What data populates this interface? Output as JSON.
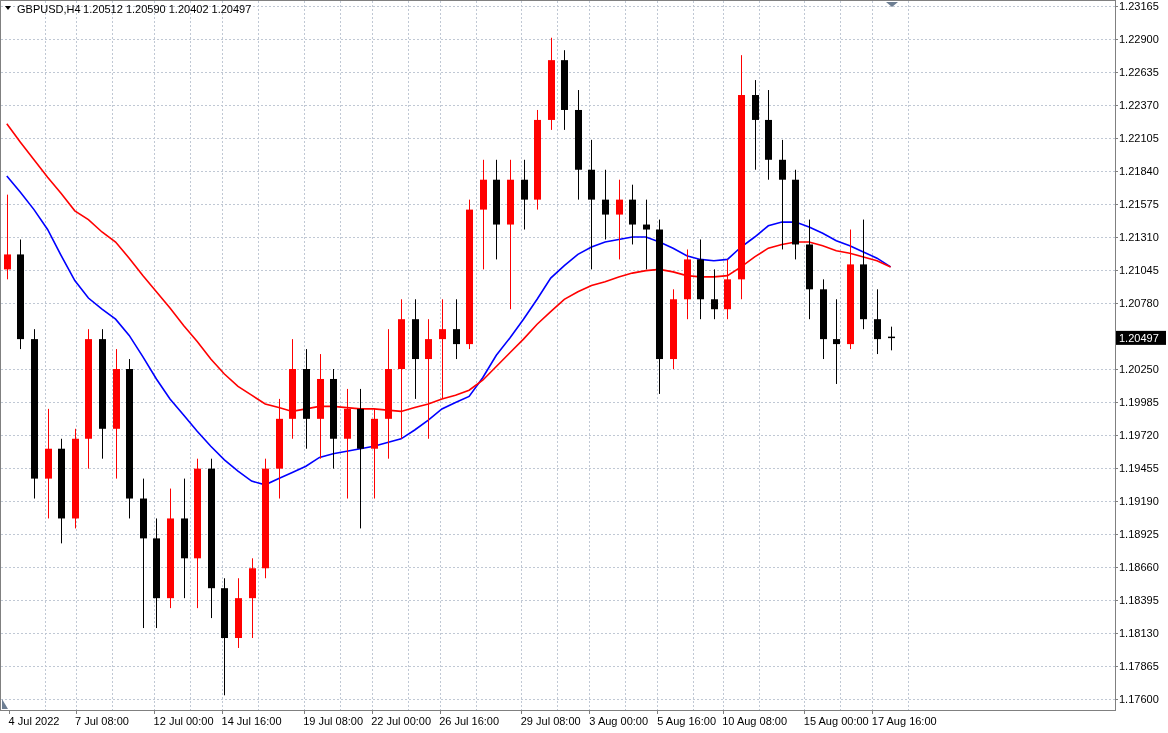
{
  "header": {
    "symbol": "GBPUSD,H4",
    "ohlc": "1.20512 1.20590 1.20402 1.20497"
  },
  "chart_data": {
    "type": "candlestick",
    "grid": true,
    "categories": [
      null,
      null,
      "4 Jul 2022",
      null,
      null,
      null,
      null,
      "7 Jul 08:00",
      null,
      null,
      null,
      null,
      null,
      "12 Jul 00:00",
      null,
      null,
      null,
      null,
      "14 Jul 16:00",
      null,
      null,
      null,
      null,
      null,
      "19 Jul 08:00",
      null,
      null,
      null,
      null,
      "22 Jul 00:00",
      null,
      null,
      null,
      null,
      "26 Jul 16:00",
      null,
      null,
      null,
      null,
      null,
      "29 Jul 08:00",
      null,
      null,
      null,
      null,
      "3 Aug 00:00",
      null,
      null,
      null,
      null,
      "5 Aug 16:00",
      null,
      null,
      null,
      null,
      "10 Aug 08:00",
      null,
      null,
      null,
      null,
      null,
      "15 Aug 00:00",
      null,
      null,
      null,
      null,
      "17 Aug 16:00",
      null,
      null,
      null,
      null,
      null,
      null,
      null,
      null,
      null,
      null,
      null,
      null,
      null,
      null,
      null
    ],
    "ylim": [
      1.17512,
      1.23213
    ],
    "yticks": [
      {
        "value": 1.23165,
        "label": "1.23165"
      },
      {
        "value": 1.229,
        "label": "1.22900"
      },
      {
        "value": 1.22635,
        "label": "1.22635"
      },
      {
        "value": 1.2237,
        "label": "1.22370"
      },
      {
        "value": 1.22105,
        "label": "1.22105"
      },
      {
        "value": 1.2184,
        "label": "1.21840"
      },
      {
        "value": 1.21575,
        "label": "1.21575"
      },
      {
        "value": 1.2131,
        "label": "1.21310"
      },
      {
        "value": 1.21045,
        "label": "1.21045"
      },
      {
        "value": 1.2078,
        "label": "1.20780"
      },
      {
        "value": 1.2025,
        "label": "1.20250"
      },
      {
        "value": 1.19985,
        "label": "1.19985"
      },
      {
        "value": 1.1972,
        "label": "1.19720"
      },
      {
        "value": 1.19455,
        "label": "1.19455"
      },
      {
        "value": 1.1919,
        "label": "1.19190"
      },
      {
        "value": 1.18925,
        "label": "1.18925"
      },
      {
        "value": 1.1866,
        "label": "1.18660"
      },
      {
        "value": 1.18395,
        "label": "1.18395"
      },
      {
        "value": 1.1813,
        "label": "1.18130"
      },
      {
        "value": 1.17865,
        "label": "1.17865"
      },
      {
        "value": 1.176,
        "label": "1.17600"
      }
    ],
    "annotations": [
      "1.20497"
    ],
    "ohlc": [
      [
        1.2105,
        1.2165,
        1.2097,
        1.2117
      ],
      [
        1.2117,
        1.2129,
        1.2041,
        1.2049
      ],
      [
        1.2049,
        1.2057,
        1.1921,
        1.1937
      ],
      [
        1.1937,
        1.1993,
        1.1905,
        1.1961
      ],
      [
        1.1961,
        1.1969,
        1.1885,
        1.1905
      ],
      [
        1.1905,
        1.1977,
        1.1897,
        1.1969
      ],
      [
        1.1969,
        1.2057,
        1.1945,
        1.2049
      ],
      [
        1.2049,
        1.2057,
        1.1953,
        1.1977
      ],
      [
        1.1977,
        1.2041,
        1.1937,
        1.2025
      ],
      [
        1.2025,
        1.2033,
        1.1905,
        1.1921
      ],
      [
        1.1921,
        1.1937,
        1.1817,
        1.1889
      ],
      [
        1.1889,
        1.1905,
        1.1817,
        1.1841
      ],
      [
        1.1841,
        1.1929,
        1.1833,
        1.1905
      ],
      [
        1.1905,
        1.1937,
        1.1841,
        1.1873
      ],
      [
        1.1873,
        1.1953,
        1.1833,
        1.1945
      ],
      [
        1.1945,
        1.1953,
        1.1825,
        1.1849
      ],
      [
        1.1849,
        1.1857,
        1.1763,
        1.1809
      ],
      [
        1.1809,
        1.1857,
        1.1801,
        1.1841
      ],
      [
        1.1841,
        1.1873,
        1.1809,
        1.1865
      ],
      [
        1.1865,
        1.1953,
        1.1857,
        1.1945
      ],
      [
        1.1945,
        1.2001,
        1.1921,
        1.1985
      ],
      [
        1.1985,
        1.2049,
        1.1969,
        1.2025
      ],
      [
        1.2025,
        1.2041,
        1.1961,
        1.1985
      ],
      [
        1.1985,
        1.2037,
        1.1953,
        1.2017
      ],
      [
        1.2017,
        1.2025,
        1.1945,
        1.1969
      ],
      [
        1.1969,
        1.2009,
        1.1921,
        1.1993
      ],
      [
        1.1993,
        1.2009,
        1.1897,
        1.1961
      ],
      [
        1.1961,
        1.1993,
        1.1921,
        1.1985
      ],
      [
        1.1985,
        1.2057,
        1.1953,
        1.2025
      ],
      [
        1.2025,
        1.2081,
        1.1969,
        1.2065
      ],
      [
        1.2065,
        1.2081,
        1.2001,
        1.2033
      ],
      [
        1.2033,
        1.2065,
        1.1969,
        1.2049
      ],
      [
        1.2049,
        1.2081,
        1.2001,
        1.2057
      ],
      [
        1.2057,
        1.2081,
        1.2033,
        1.2045
      ],
      [
        1.2045,
        1.2161,
        1.2041,
        1.2153
      ],
      [
        1.2153,
        1.2193,
        1.2105,
        1.2177
      ],
      [
        1.2177,
        1.2193,
        1.2113,
        1.2141
      ],
      [
        1.2141,
        1.2193,
        1.2073,
        1.2177
      ],
      [
        1.2177,
        1.2193,
        1.2137,
        1.2161
      ],
      [
        1.2161,
        1.2233,
        1.2153,
        1.2225
      ],
      [
        1.2225,
        1.2291,
        1.2217,
        1.2273
      ],
      [
        1.2273,
        1.2281,
        1.2217,
        1.2233
      ],
      [
        1.2233,
        1.2249,
        1.2161,
        1.2185
      ],
      [
        1.2185,
        1.2209,
        1.2105,
        1.2161
      ],
      [
        1.2161,
        1.2185,
        1.2129,
        1.2149
      ],
      [
        1.2149,
        1.2177,
        1.2113,
        1.2161
      ],
      [
        1.2161,
        1.2173,
        1.2125,
        1.2141
      ],
      [
        1.2141,
        1.2161,
        1.2105,
        1.2137
      ],
      [
        1.2137,
        1.2145,
        1.2005,
        1.2033
      ],
      [
        1.2033,
        1.2089,
        1.2025,
        1.2081
      ],
      [
        1.2081,
        1.2121,
        1.2065,
        1.2113
      ],
      [
        1.2113,
        1.2129,
        1.2065,
        1.2081
      ],
      [
        1.2081,
        1.2105,
        1.2065,
        1.2073
      ],
      [
        1.2073,
        1.2113,
        1.2065,
        1.2097
      ],
      [
        1.2097,
        1.2277,
        1.2081,
        1.2245
      ],
      [
        1.2245,
        1.2257,
        1.2185,
        1.2225
      ],
      [
        1.2225,
        1.2249,
        1.2177,
        1.2193
      ],
      [
        1.2193,
        1.2209,
        1.2121,
        1.2177
      ],
      [
        1.2177,
        1.2185,
        1.2113,
        1.2125
      ],
      [
        1.2125,
        1.2145,
        1.2065,
        1.2089
      ],
      [
        1.2089,
        1.2097,
        1.2033,
        1.2049
      ],
      [
        1.2049,
        1.2081,
        1.2013,
        1.2045
      ],
      [
        1.2045,
        1.2137,
        1.2041,
        1.2109
      ],
      [
        1.2109,
        1.2145,
        1.2057,
        1.2065
      ],
      [
        1.2065,
        1.2089,
        1.2037,
        1.2049
      ],
      [
        1.2051,
        1.2059,
        1.204,
        1.205
      ],
      null,
      null,
      null,
      null,
      null,
      null,
      null,
      null,
      null,
      null,
      null,
      null,
      null,
      null,
      null,
      null
    ],
    "series": [
      {
        "type": "line",
        "color": "#0000ff",
        "values": [
          1.218,
          1.2167,
          1.2153,
          1.2137,
          1.2116,
          1.2096,
          1.2082,
          1.2073,
          1.2065,
          1.2052,
          1.2035,
          1.2017,
          1.2001,
          1.1988,
          1.1975,
          1.1963,
          1.1952,
          1.1943,
          1.1935,
          1.1932,
          1.1937,
          1.1942,
          1.1947,
          1.1954,
          1.1957,
          1.1959,
          1.1961,
          1.1963,
          1.1966,
          1.1969,
          1.1976,
          1.1984,
          1.1993,
          1.1998,
          1.2003,
          1.2018,
          1.2036,
          1.205,
          1.2065,
          1.2081,
          1.2098,
          1.2108,
          1.2117,
          1.2123,
          1.2127,
          1.2129,
          1.2131,
          1.2131,
          1.2127,
          1.2122,
          1.2116,
          1.2113,
          1.2112,
          1.2113,
          1.2123,
          1.2131,
          1.214,
          1.2143,
          1.2143,
          1.2139,
          1.2134,
          1.2128,
          1.2124,
          1.2119,
          1.2114,
          1.2107,
          null,
          null,
          null,
          null,
          null,
          null,
          null,
          null,
          null,
          null,
          null,
          null,
          null,
          null,
          null,
          null
        ]
      },
      {
        "type": "line",
        "color": "#ff0000",
        "values": [
          1.2222,
          1.2207,
          1.2193,
          1.2179,
          1.2166,
          1.2152,
          1.2145,
          1.2135,
          1.2127,
          1.2114,
          1.21,
          1.2087,
          1.2074,
          1.206,
          1.2047,
          1.2033,
          1.2021,
          1.2011,
          1.2004,
          1.1997,
          1.1994,
          1.1991,
          1.1993,
          1.1995,
          1.1995,
          1.1994,
          1.1993,
          1.1993,
          1.1992,
          1.1991,
          1.1994,
          1.1997,
          1.2001,
          1.2004,
          1.2008,
          1.2016,
          1.2027,
          1.2038,
          1.2049,
          1.2061,
          1.2071,
          1.2081,
          1.2087,
          1.2092,
          1.2095,
          1.2099,
          1.2102,
          1.2104,
          1.2105,
          1.2103,
          1.21,
          1.2099,
          1.2099,
          1.21,
          1.2107,
          1.2115,
          1.2122,
          1.2125,
          1.2127,
          1.2127,
          1.2124,
          1.212,
          1.2118,
          1.2115,
          1.2112,
          1.2107,
          null,
          null,
          null,
          null,
          null,
          null,
          null,
          null,
          null,
          null,
          null,
          null,
          null,
          null,
          null,
          null
        ]
      }
    ]
  }
}
